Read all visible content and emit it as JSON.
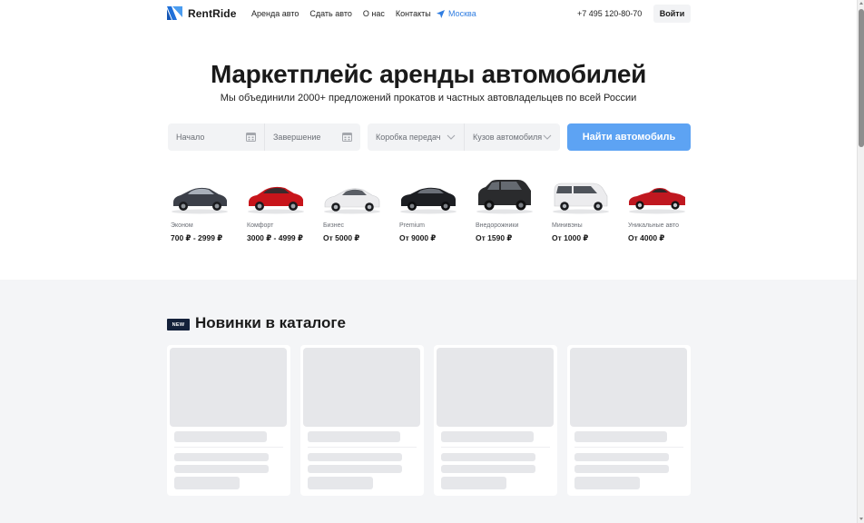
{
  "header": {
    "logo_text": "RentRide",
    "nav": [
      "Аренда авто",
      "Сдать авто",
      "О нас",
      "Контакты"
    ],
    "city": "Москва",
    "phone": "+7 495 120-80-70",
    "login_label": "Войти"
  },
  "hero": {
    "title": "Маркетплейс аренды автомобилей",
    "subtitle": "Мы объединили 2000+ предложений прокатов и частных автовладельцев по всей России"
  },
  "search": {
    "start_placeholder": "Начало",
    "end_placeholder": "Завершение",
    "gearbox_placeholder": "Коробка передач",
    "body_placeholder": "Кузов автомобиля",
    "submit_label": "Найти автомобиль"
  },
  "categories": [
    {
      "name": "Эконом",
      "price": "700 ₽ - 2999 ₽",
      "color": "#3c4049",
      "icon": "sedan-car-icon"
    },
    {
      "name": "Комфорт",
      "price": "3000 ₽ - 4999 ₽",
      "color": "#c8151b",
      "icon": "sedan-car-icon"
    },
    {
      "name": "Бизнес",
      "price": "От 5000 ₽",
      "color": "#e8e8ea",
      "icon": "coupe-car-icon"
    },
    {
      "name": "Premium",
      "price": "От 9000 ₽",
      "color": "#1d1f23",
      "icon": "muscle-car-icon"
    },
    {
      "name": "Внедорожники",
      "price": "От 1590 ₽",
      "color": "#2a2b2d",
      "icon": "suv-car-icon"
    },
    {
      "name": "Минивэны",
      "price": "От 1000 ₽",
      "color": "#ececee",
      "icon": "minivan-icon"
    },
    {
      "name": "Уникальные авто",
      "price": "От 4000 ₽",
      "color": "#c01820",
      "icon": "classic-car-icon"
    }
  ],
  "catalog": {
    "badge": "NEW",
    "title": "Новинки в каталоге",
    "cards_count_label": ""
  },
  "colors": {
    "accent": "#5da3f3",
    "link": "#2f7de1",
    "section_bg": "#f4f5f7",
    "badge_bg": "#14213a"
  }
}
